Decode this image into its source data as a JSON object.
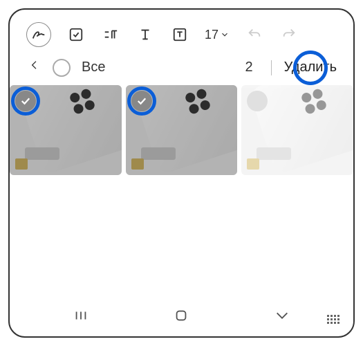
{
  "toolbar": {
    "font_size": "17"
  },
  "selection": {
    "all_label": "Все",
    "count": "2",
    "delete_label": "Удалить"
  },
  "gallery": {
    "items": [
      {
        "selected": true
      },
      {
        "selected": true
      },
      {
        "selected": false
      }
    ]
  },
  "colors": {
    "highlight": "#0b5ed7"
  }
}
